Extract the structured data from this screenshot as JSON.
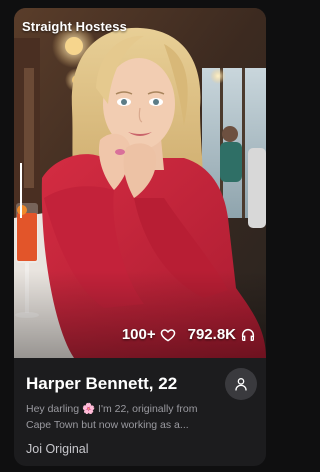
{
  "card": {
    "badge": "Straight Hostess",
    "stats": {
      "likes": "100+",
      "likes_icon": "heart-icon",
      "listens": "792.8K",
      "listens_icon": "headphones-icon"
    },
    "name": "Harper Bennett, 22",
    "bio_before_emoji": "Hey darling ",
    "bio_emoji": "🌸",
    "bio_after_emoji": " I'm 22, originally from Cape Town but now working as a...",
    "category": "Joi Original",
    "profile_button_icon": "user-icon"
  },
  "colors": {
    "background": "#0f0f10",
    "card": "#1c1c1e",
    "dress": "#c8243a",
    "muted_text": "#9a9aa0"
  }
}
